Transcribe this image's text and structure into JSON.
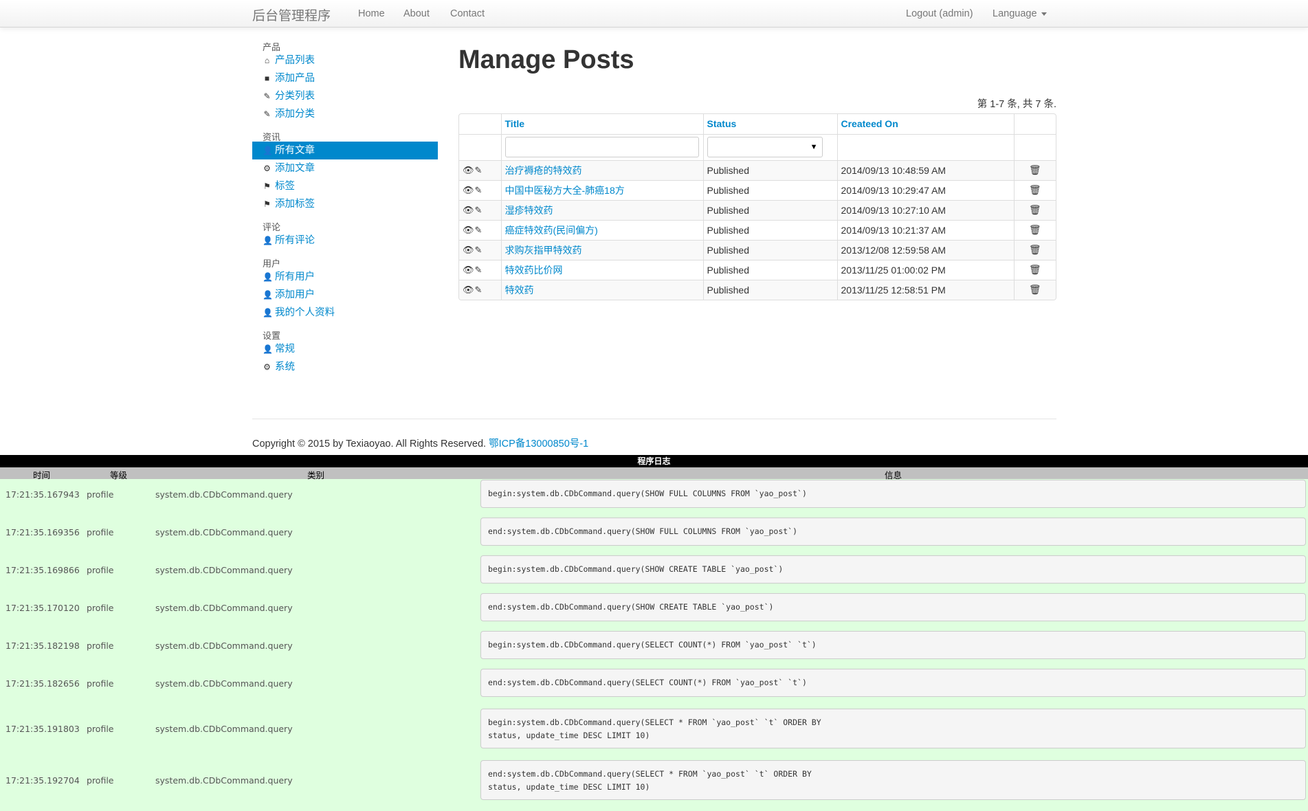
{
  "navbar": {
    "brand": "后台管理程序",
    "links": [
      "Home",
      "About",
      "Contact"
    ],
    "logout": "Logout (admin)",
    "language": "Language"
  },
  "sidebar": {
    "sections": [
      {
        "header": "产品",
        "items": [
          {
            "label": "产品列表",
            "icon": "home-icon",
            "glyph": "⌂"
          },
          {
            "label": "添加产品",
            "icon": "book-icon",
            "glyph": "■"
          },
          {
            "label": "分类列表",
            "icon": "pencil-icon",
            "glyph": "✎"
          },
          {
            "label": "添加分类",
            "icon": "pencil-icon",
            "glyph": "✎"
          }
        ]
      },
      {
        "header": "资讯",
        "items": [
          {
            "label": "所有文章",
            "icon": "user-icon",
            "glyph": "👤",
            "active": true
          },
          {
            "label": "添加文章",
            "icon": "cog-icon",
            "glyph": "⚙"
          },
          {
            "label": "标签",
            "icon": "flag-icon",
            "glyph": "⚑"
          },
          {
            "label": "添加标签",
            "icon": "flag-icon",
            "glyph": "⚑"
          }
        ]
      },
      {
        "header": "评论",
        "items": [
          {
            "label": "所有评论",
            "icon": "user-icon",
            "glyph": "👤"
          }
        ]
      },
      {
        "header": "用户",
        "items": [
          {
            "label": "所有用户",
            "icon": "user-icon",
            "glyph": "👤"
          },
          {
            "label": "添加用户",
            "icon": "user-icon",
            "glyph": "👤"
          },
          {
            "label": "我的个人资料",
            "icon": "user-icon",
            "glyph": "👤"
          }
        ]
      },
      {
        "header": "设置",
        "items": [
          {
            "label": "常规",
            "icon": "user-icon",
            "glyph": "👤"
          },
          {
            "label": "系统",
            "icon": "cog-icon",
            "glyph": "⚙"
          }
        ]
      }
    ]
  },
  "main": {
    "title": "Manage Posts",
    "summary": "第 1-7 条, 共 7 条.",
    "columns": [
      "Title",
      "Status",
      "Createed On"
    ],
    "filter_select_value": "",
    "row_actions": {
      "view_glyph": "👁",
      "edit_glyph": "✎",
      "delete_glyph": "🗑"
    },
    "rows": [
      {
        "title": "治疗褥疮的特效药",
        "status": "Published",
        "created": "2014/09/13 10:48:59 AM"
      },
      {
        "title": "中国中医秘方大全-肺癌18方",
        "status": "Published",
        "created": "2014/09/13 10:29:47 AM"
      },
      {
        "title": " 湿疹特效药",
        "status": "Published",
        "created": "2014/09/13 10:27:10 AM"
      },
      {
        "title": "癌症特效药(民间偏方)",
        "status": "Published",
        "created": "2014/09/13 10:21:37 AM"
      },
      {
        "title": "求购灰指甲特效药",
        "status": "Published",
        "created": "2013/12/08 12:59:58 AM"
      },
      {
        "title": "特效药比价网",
        "status": "Published",
        "created": "2013/11/25 01:00:02 PM"
      },
      {
        "title": "特效药",
        "status": "Published",
        "created": "2013/11/25 12:58:51 PM"
      }
    ]
  },
  "footer": {
    "text": "Copyright © 2015 by Texiaoyao. All Rights Reserved. ",
    "icp": "鄂ICP备13000850号-1"
  },
  "log": {
    "title": "程序日志",
    "headers": [
      "时间",
      "等级",
      "类别",
      "信息"
    ],
    "rows": [
      {
        "time": "17:21:35.167943",
        "level": "profile",
        "category": "system.db.CDbCommand.query",
        "message": "begin:system.db.CDbCommand.query(SHOW FULL COLUMNS FROM `yao_post`)"
      },
      {
        "time": "17:21:35.169356",
        "level": "profile",
        "category": "system.db.CDbCommand.query",
        "message": "end:system.db.CDbCommand.query(SHOW FULL COLUMNS FROM `yao_post`)"
      },
      {
        "time": "17:21:35.169866",
        "level": "profile",
        "category": "system.db.CDbCommand.query",
        "message": "begin:system.db.CDbCommand.query(SHOW CREATE TABLE `yao_post`)"
      },
      {
        "time": "17:21:35.170120",
        "level": "profile",
        "category": "system.db.CDbCommand.query",
        "message": "end:system.db.CDbCommand.query(SHOW CREATE TABLE `yao_post`)"
      },
      {
        "time": "17:21:35.182198",
        "level": "profile",
        "category": "system.db.CDbCommand.query",
        "message": "begin:system.db.CDbCommand.query(SELECT COUNT(*) FROM `yao_post` `t`)"
      },
      {
        "time": "17:21:35.182656",
        "level": "profile",
        "category": "system.db.CDbCommand.query",
        "message": "end:system.db.CDbCommand.query(SELECT COUNT(*) FROM `yao_post` `t`)"
      },
      {
        "time": "17:21:35.191803",
        "level": "profile",
        "category": "system.db.CDbCommand.query",
        "message": "begin:system.db.CDbCommand.query(SELECT * FROM `yao_post` `t` ORDER BY\nstatus, update_time DESC LIMIT 10)"
      },
      {
        "time": "17:21:35.192704",
        "level": "profile",
        "category": "system.db.CDbCommand.query",
        "message": "end:system.db.CDbCommand.query(SELECT * FROM `yao_post` `t` ORDER BY\nstatus, update_time DESC LIMIT 10)"
      }
    ]
  },
  "colors": {
    "link": "#0088cc",
    "active_bg": "#0088cc",
    "log_bg": "#dfffdf",
    "log_header": "#c0c0c0"
  }
}
